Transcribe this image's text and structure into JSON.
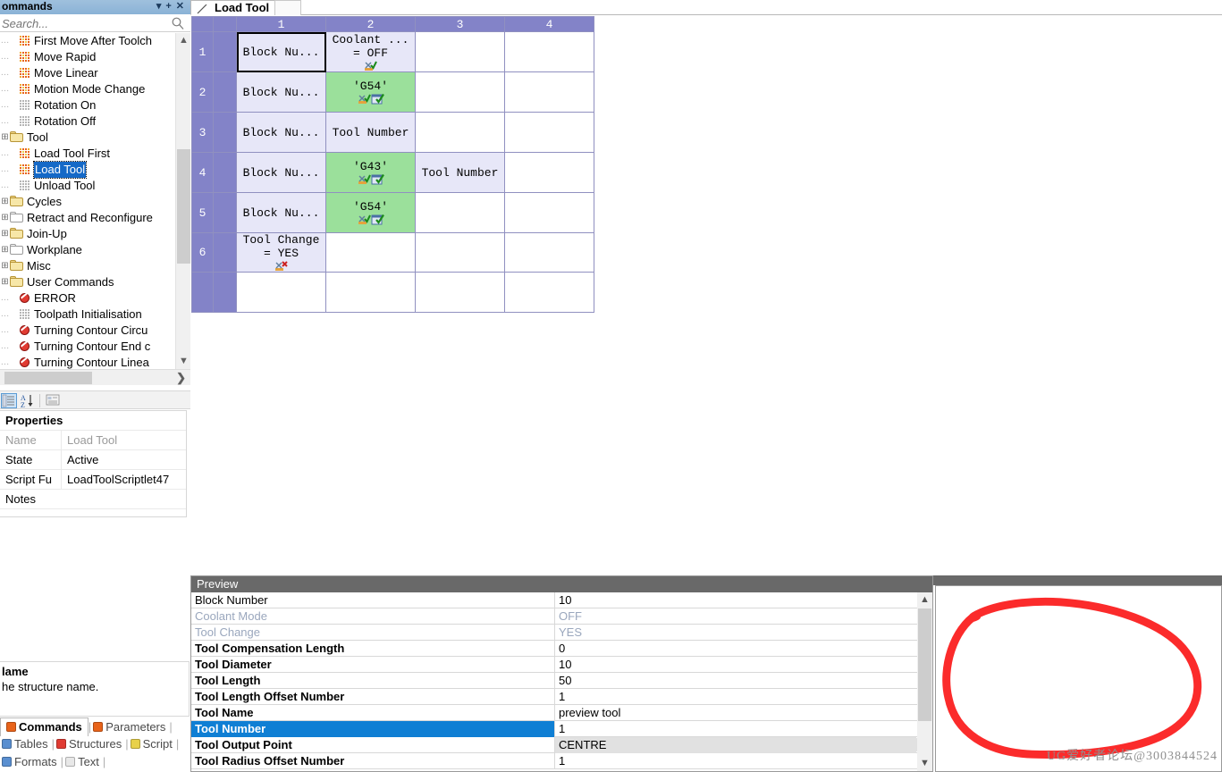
{
  "dock": {
    "title": "ommands",
    "buttons": [
      {
        "name": "dropdown-icon",
        "glyph": "▾"
      },
      {
        "name": "pin-icon",
        "glyph": "+"
      },
      {
        "name": "close-icon",
        "glyph": "✕"
      }
    ],
    "search_placeholder": "Search...",
    "search_value": ""
  },
  "tree": {
    "items": [
      {
        "label": "First Move After Toolch",
        "icon": "command-icon",
        "indent": 1,
        "type": "cmd",
        "sel": false
      },
      {
        "label": "Move Rapid",
        "icon": "command-icon",
        "indent": 1,
        "type": "cmd",
        "sel": false
      },
      {
        "label": "Move Linear",
        "icon": "command-icon",
        "indent": 1,
        "type": "cmd",
        "sel": false
      },
      {
        "label": "Motion Mode Change",
        "icon": "command-icon",
        "indent": 1,
        "type": "cmd",
        "sel": false
      },
      {
        "label": "Rotation On",
        "icon": "command-disabled-icon",
        "indent": 1,
        "type": "dis",
        "sel": false
      },
      {
        "label": "Rotation Off",
        "icon": "command-disabled-icon",
        "indent": 1,
        "type": "dis",
        "sel": false
      },
      {
        "label": "Tool",
        "icon": "folder-open-icon",
        "indent": 0,
        "type": "folder",
        "sel": false
      },
      {
        "label": "Load Tool First",
        "icon": "command-icon",
        "indent": 1,
        "type": "cmd",
        "sel": false
      },
      {
        "label": "Load Tool",
        "icon": "command-icon",
        "indent": 1,
        "type": "cmd",
        "sel": true
      },
      {
        "label": "Unload Tool",
        "icon": "command-disabled-icon",
        "indent": 1,
        "type": "dis",
        "sel": false
      },
      {
        "label": "Cycles",
        "icon": "folder-open-icon",
        "indent": 0,
        "type": "folder",
        "sel": false
      },
      {
        "label": "Retract and Reconfigure",
        "icon": "folder-empty-icon",
        "indent": 0,
        "type": "folder-plain",
        "sel": false
      },
      {
        "label": "Join-Up",
        "icon": "folder-open-icon",
        "indent": 0,
        "type": "folder",
        "sel": false
      },
      {
        "label": "Workplane",
        "icon": "folder-empty-icon",
        "indent": 0,
        "type": "folder-plain",
        "sel": false
      },
      {
        "label": "Misc",
        "icon": "folder-open-icon",
        "indent": 0,
        "type": "folder",
        "sel": false
      },
      {
        "label": "User Commands",
        "icon": "folder-open-icon",
        "indent": 0,
        "type": "folder",
        "sel": false
      },
      {
        "label": "ERROR",
        "icon": "error-icon",
        "indent": 1,
        "type": "err",
        "sel": false
      },
      {
        "label": "Toolpath Initialisation",
        "icon": "command-disabled-icon",
        "indent": 1,
        "type": "dis",
        "sel": false
      },
      {
        "label": "Turning Contour Circu",
        "icon": "error-icon",
        "indent": 1,
        "type": "err",
        "sel": false
      },
      {
        "label": "Turning Contour End c",
        "icon": "error-icon",
        "indent": 1,
        "type": "err",
        "sel": false
      },
      {
        "label": "Turning Contour Linea",
        "icon": "error-icon",
        "indent": 1,
        "type": "err",
        "sel": false
      }
    ]
  },
  "properties": {
    "header": "Properties",
    "rows": [
      {
        "key": "Name",
        "value": "Load Tool",
        "dim": true
      },
      {
        "key": "State",
        "value": "Active",
        "dim": false
      },
      {
        "key": "Script Fu",
        "value": "LoadToolScriptlet47",
        "dim": false
      },
      {
        "key": "Notes",
        "value": "",
        "dim": false
      }
    ]
  },
  "help": {
    "title": "lame",
    "text": "he structure name."
  },
  "bottom_tabs": {
    "row1": [
      {
        "label": "Commands",
        "active": true,
        "color": "#e8631a"
      },
      {
        "label": "Parameters",
        "active": false,
        "color": "#e8631a"
      }
    ],
    "row2": [
      {
        "label": "Tables",
        "active": false,
        "color": "#5a8fd0"
      },
      {
        "label": "Structures",
        "active": false,
        "color": "#e03b32"
      },
      {
        "label": "Script",
        "active": false,
        "color": "#e8d14a"
      }
    ],
    "row3": [
      {
        "label": "Formats",
        "active": false,
        "color": "#5a8fd0"
      },
      {
        "label": "Text",
        "active": false,
        "color": "#e8e8e8"
      }
    ]
  },
  "document_tab": {
    "label": "Load Tool"
  },
  "grid": {
    "column_headers": [
      "1",
      "2",
      "3",
      "4"
    ],
    "row_headers": [
      "1",
      "2",
      "3",
      "4",
      "5",
      "6",
      ""
    ],
    "rows": [
      {
        "cells": [
          {
            "text": "Block Nu...",
            "style": "cell",
            "active": true,
            "icons": []
          },
          {
            "text": "Coolant ...\n= OFF",
            "style": "cell",
            "active": false,
            "icons": [
              "scissors-check-icon"
            ]
          },
          {
            "text": "",
            "style": "empty",
            "active": false,
            "icons": []
          },
          {
            "text": "",
            "style": "empty",
            "active": false,
            "icons": []
          }
        ]
      },
      {
        "cells": [
          {
            "text": "Block Nu...",
            "style": "cell",
            "active": false,
            "icons": []
          },
          {
            "text": "'G54'",
            "style": "green",
            "active": false,
            "icons": [
              "scissors-check-icon",
              "window-check-icon"
            ]
          },
          {
            "text": "",
            "style": "empty",
            "active": false,
            "icons": []
          },
          {
            "text": "",
            "style": "empty",
            "active": false,
            "icons": []
          }
        ]
      },
      {
        "cells": [
          {
            "text": "Block Nu...",
            "style": "cell",
            "active": false,
            "icons": []
          },
          {
            "text": "Tool Number",
            "style": "cell",
            "active": false,
            "icons": []
          },
          {
            "text": "",
            "style": "empty",
            "active": false,
            "icons": []
          },
          {
            "text": "",
            "style": "empty",
            "active": false,
            "icons": []
          }
        ]
      },
      {
        "cells": [
          {
            "text": "Block Nu...",
            "style": "cell",
            "active": false,
            "icons": []
          },
          {
            "text": "'G43'",
            "style": "green",
            "active": false,
            "icons": [
              "scissors-check-icon",
              "window-check-icon"
            ]
          },
          {
            "text": "Tool Number",
            "style": "cell",
            "active": false,
            "icons": []
          },
          {
            "text": "",
            "style": "empty",
            "active": false,
            "icons": []
          }
        ]
      },
      {
        "cells": [
          {
            "text": "Block Nu...",
            "style": "cell",
            "active": false,
            "icons": []
          },
          {
            "text": "'G54'",
            "style": "green",
            "active": false,
            "icons": [
              "scissors-check-icon",
              "window-check-icon"
            ]
          },
          {
            "text": "",
            "style": "empty",
            "active": false,
            "icons": []
          },
          {
            "text": "",
            "style": "empty",
            "active": false,
            "icons": []
          }
        ]
      },
      {
        "cells": [
          {
            "text": "Tool Change\n= YES",
            "style": "cell",
            "active": false,
            "icons": [
              "scissors-cross-icon"
            ]
          },
          {
            "text": "",
            "style": "empty",
            "active": false,
            "icons": []
          },
          {
            "text": "",
            "style": "empty",
            "active": false,
            "icons": []
          },
          {
            "text": "",
            "style": "empty",
            "active": false,
            "icons": []
          }
        ]
      },
      {
        "cells": [
          {
            "text": "",
            "style": "empty",
            "active": false,
            "icons": []
          },
          {
            "text": "",
            "style": "empty",
            "active": false,
            "icons": []
          },
          {
            "text": "",
            "style": "empty",
            "active": false,
            "icons": []
          },
          {
            "text": "",
            "style": "empty",
            "active": false,
            "icons": []
          }
        ]
      }
    ]
  },
  "preview": {
    "title": "Preview",
    "rows": [
      {
        "key": "Block Number",
        "value": "10",
        "style": "norm"
      },
      {
        "key": "Coolant Mode",
        "value": "OFF",
        "style": "dim"
      },
      {
        "key": "Tool Change",
        "value": "YES",
        "style": "dim"
      },
      {
        "key": "Tool Compensation Length",
        "value": "0",
        "style": "bold"
      },
      {
        "key": "Tool Diameter",
        "value": "10",
        "style": "bold"
      },
      {
        "key": "Tool Length",
        "value": "50",
        "style": "bold"
      },
      {
        "key": "Tool Length Offset Number",
        "value": "1",
        "style": "bold"
      },
      {
        "key": "Tool Name",
        "value": "preview tool",
        "style": "bold"
      },
      {
        "key": "Tool Number",
        "value": "1",
        "style": "selected"
      },
      {
        "key": "Tool Output Point",
        "value": "CENTRE",
        "style": "combo"
      },
      {
        "key": "Tool Radius Offset Number",
        "value": "1",
        "style": "bold"
      }
    ]
  },
  "annotation": {
    "shape": "hand-drawn-ellipse",
    "color": "#fb2b2b"
  },
  "watermark": {
    "text": "UG爱好者论坛@3003844524"
  },
  "colors": {
    "grid_header": "#8383c8",
    "grid_cell": "#e7e7f8",
    "grid_green": "#9be09b",
    "selection_blue": "#1569c7",
    "preview_header": "#696969",
    "annotation_red": "#fb2b2b"
  }
}
